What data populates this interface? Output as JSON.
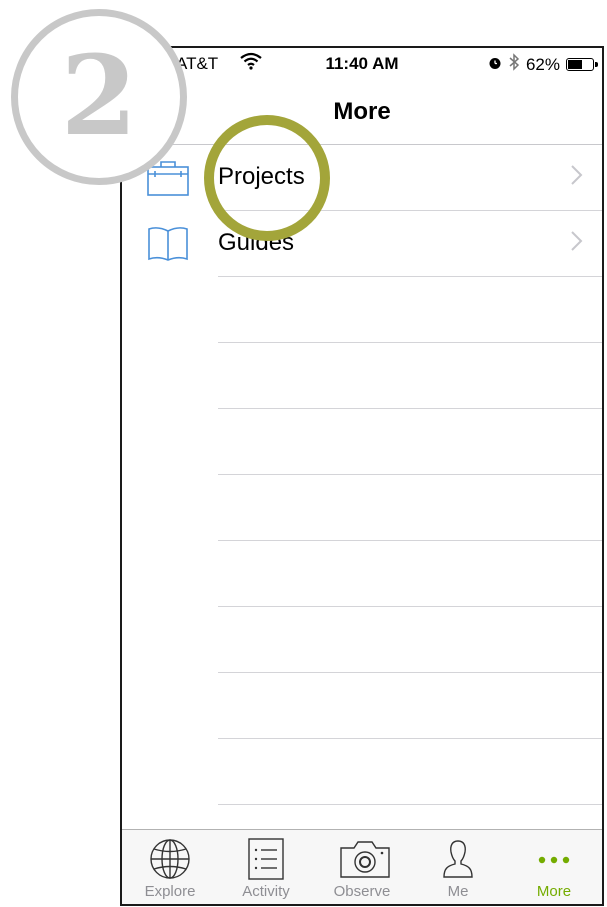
{
  "overlay": {
    "step_number": "2"
  },
  "status": {
    "carrier": "AT&T",
    "time": "11:40 AM",
    "battery_percent": "62%",
    "battery_level": 0.62
  },
  "nav": {
    "title": "More"
  },
  "menu": [
    {
      "label": "Projects",
      "icon": "briefcase-icon"
    },
    {
      "label": "Guides",
      "icon": "book-icon"
    }
  ],
  "tabs": [
    {
      "label": "Explore",
      "icon": "globe-icon",
      "active": false
    },
    {
      "label": "Activity",
      "icon": "list-icon",
      "active": false
    },
    {
      "label": "Observe",
      "icon": "camera-icon",
      "active": false
    },
    {
      "label": "Me",
      "icon": "person-icon",
      "active": false
    },
    {
      "label": "More",
      "icon": "ellipsis-icon",
      "active": true
    }
  ],
  "colors": {
    "accent": "#74ac00",
    "icon_blue": "#4a90d9",
    "highlight_ring": "#a3a53a",
    "badge_gray": "#c8c8c8"
  }
}
